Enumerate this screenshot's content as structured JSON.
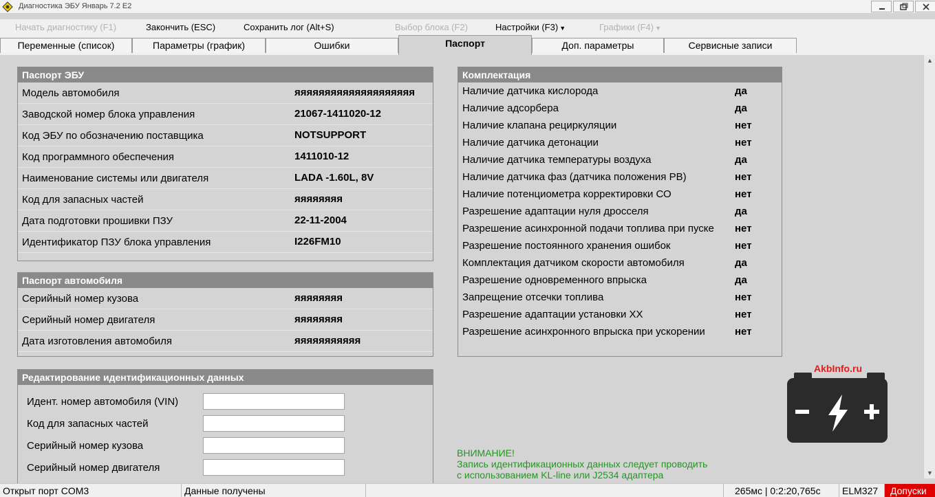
{
  "window": {
    "title": "Диагностика ЭБУ Январь 7.2 E2"
  },
  "menu": {
    "start": "Начать диагностику (F1)",
    "finish": "Закончить (ESC)",
    "save_log": "Сохранить лог (Alt+S)",
    "select_block": "Выбор блока (F2)",
    "settings": "Настройки (F3)",
    "graphs": "Графики (F4)"
  },
  "tabs": [
    {
      "label": "Переменные (список)"
    },
    {
      "label": "Параметры (график)"
    },
    {
      "label": "Ошибки"
    },
    {
      "label": "Паспорт"
    },
    {
      "label": "Доп. параметры"
    },
    {
      "label": "Сервисные записи"
    }
  ],
  "ecu_passport": {
    "title": "Паспорт ЭБУ",
    "rows": [
      {
        "label": "Модель автомобиля",
        "value": "яяяяяяяяяяяяяяяяяяяя"
      },
      {
        "label": "Заводской номер блока управления",
        "value": "21067-1411020-12"
      },
      {
        "label": "Код ЭБУ по обозначению поставщика",
        "value": "NOTSUPPORT"
      },
      {
        "label": "Код программного обеспечения",
        "value": "1411010-12"
      },
      {
        "label": "Наименование системы или двигателя",
        "value": "LADA -1.60L, 8V"
      },
      {
        "label": "Код для запасных частей",
        "value": "яяяяяяяя"
      },
      {
        "label": "Дата подготовки прошивки ПЗУ",
        "value": "22-11-2004"
      },
      {
        "label": "Идентификатор ПЗУ блока управления",
        "value": "I226FM10"
      }
    ]
  },
  "car_passport": {
    "title": "Паспорт автомобиля",
    "rows": [
      {
        "label": "Серийный номер кузова",
        "value": "яяяяяяяя"
      },
      {
        "label": "Серийный номер двигателя",
        "value": "яяяяяяяя"
      },
      {
        "label": "Дата изготовления автомобиля",
        "value": "яяяяяяяяяяя"
      }
    ]
  },
  "edit_panel": {
    "title": "Редактирование идентификационных данных",
    "fields": [
      {
        "label": "Идент. номер автомобиля (VIN)",
        "value": ""
      },
      {
        "label": "Код для запасных частей",
        "value": ""
      },
      {
        "label": "Серийный номер кузова",
        "value": ""
      },
      {
        "label": "Серийный номер двигателя",
        "value": ""
      }
    ]
  },
  "configuration": {
    "title": "Комплектация",
    "rows": [
      {
        "label": "Наличие датчика кислорода",
        "value": "да"
      },
      {
        "label": "Наличие адсорбера",
        "value": "да"
      },
      {
        "label": "Наличие клапана рециркуляции",
        "value": "нет"
      },
      {
        "label": "Наличие датчика детонации",
        "value": "нет"
      },
      {
        "label": "Наличие датчика температуры воздуха",
        "value": "да"
      },
      {
        "label": "Наличие датчика фаз (датчика положения РВ)",
        "value": "нет"
      },
      {
        "label": "Наличие потенциометра корректировки СО",
        "value": "нет"
      },
      {
        "label": "Разрешение адаптации нуля дросселя",
        "value": "да"
      },
      {
        "label": "Разрешение асинхронной подачи топлива при пуске",
        "value": "нет"
      },
      {
        "label": "Разрешение постоянного хранения ошибок",
        "value": "нет"
      },
      {
        "label": "Комплектация датчиком скорости автомобиля",
        "value": "да"
      },
      {
        "label": "Разрешение одновременного впрыска",
        "value": "да"
      },
      {
        "label": "Запрещение отсечки топлива",
        "value": "нет"
      },
      {
        "label": "Разрешение адаптации установки ХХ",
        "value": "нет"
      },
      {
        "label": "Разрешение асинхронного впрыска при ускорении",
        "value": "нет"
      }
    ]
  },
  "warning": {
    "title": "ВНИМАНИЕ!",
    "line1": "Запись идентификационных данных следует проводить",
    "line2": "с использованием KL-line или J2534 адаптера"
  },
  "logo": {
    "text": "AkbInfo.ru"
  },
  "status": {
    "port": "Открыт порт COM3",
    "data": "Данные получены",
    "timing": "265мс | 0:2:20,765с",
    "adapter": "ELM327",
    "tolerances": "Допуски"
  },
  "colors": {
    "panel_header": "#8a8a8a",
    "warning": "#1e9a1e",
    "alert": "#e10000"
  }
}
